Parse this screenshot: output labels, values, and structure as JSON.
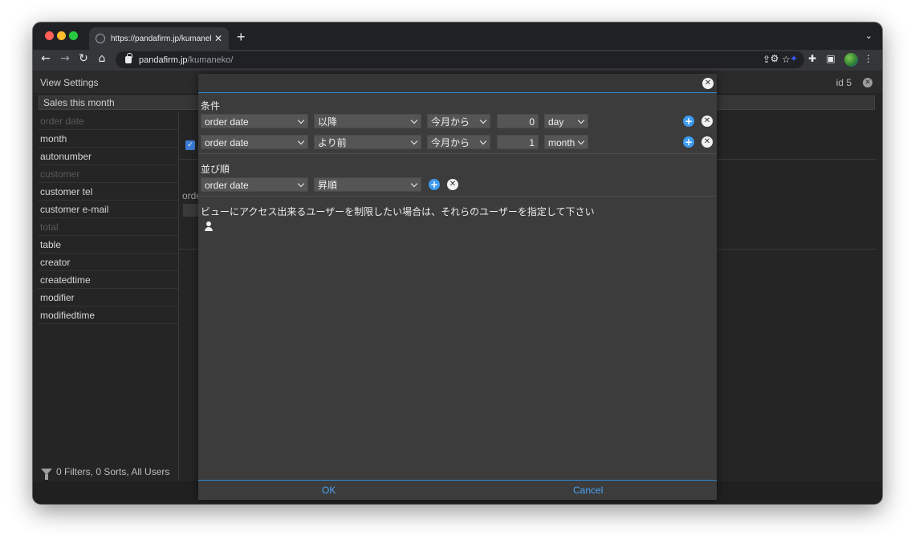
{
  "browser": {
    "tab_title": "https://pandafirm.jp/kumaneko/",
    "tab_close": "✕",
    "new_tab": "+",
    "url_host": "pandafirm.jp",
    "url_path": "/kumaneko/"
  },
  "page": {
    "header_title": "View Settings",
    "id_label": "id 5",
    "view_name": "Sales this month",
    "fields": [
      {
        "label": "order date",
        "dim": true
      },
      {
        "label": "month",
        "dim": false
      },
      {
        "label": "autonumber",
        "dim": false
      },
      {
        "label": "customer",
        "dim": true
      },
      {
        "label": "customer tel",
        "dim": false
      },
      {
        "label": "customer e-mail",
        "dim": false
      },
      {
        "label": "total",
        "dim": true
      },
      {
        "label": "table",
        "dim": false
      },
      {
        "label": "creator",
        "dim": false
      },
      {
        "label": "createdtime",
        "dim": false
      },
      {
        "label": "modifier",
        "dim": false
      },
      {
        "label": "modifiedtime",
        "dim": false
      }
    ],
    "background_order_label": "order",
    "status_text": "0 Filters, 0 Sorts, All Users"
  },
  "modal": {
    "conditions_label": "条件",
    "conditions": [
      {
        "field": "order date",
        "operator": "以降",
        "base": "今月から",
        "amount": "0",
        "unit": "day"
      },
      {
        "field": "order date",
        "operator": "より前",
        "base": "今月から",
        "amount": "1",
        "unit": "month"
      }
    ],
    "sort_label": "並び順",
    "sort": {
      "field": "order date",
      "order": "昇順"
    },
    "access_text": "ビューにアクセス出来るユーザーを制限したい場合は、それらのユーザーを指定して下さい",
    "ok_label": "OK",
    "cancel_label": "Cancel"
  },
  "colors": {
    "accent": "#3d9bf0",
    "modal_bg": "#3c3c3c",
    "page_bg": "#252526"
  },
  "icons": [
    "globe-icon",
    "lock-icon",
    "share-icon",
    "star-icon",
    "gear-icon",
    "puzzle-icon",
    "sidebar-icon",
    "funnel-icon",
    "close-icon",
    "plus-icon",
    "user-icon",
    "chevron-down-icon"
  ]
}
